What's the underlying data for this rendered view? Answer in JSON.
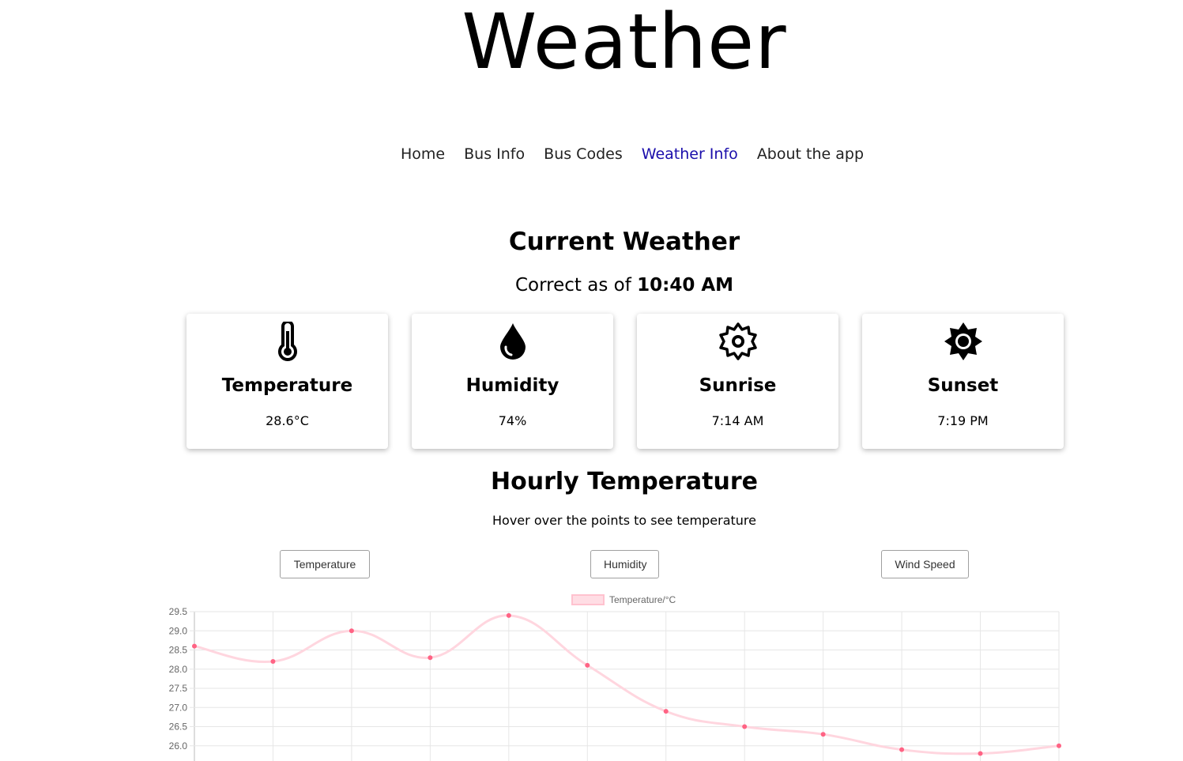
{
  "header": {
    "title": "Weather"
  },
  "nav": {
    "items": [
      {
        "label": "Home"
      },
      {
        "label": "Bus Info"
      },
      {
        "label": "Bus Codes"
      },
      {
        "label": "Weather Info",
        "active": true
      },
      {
        "label": "About the app"
      }
    ],
    "active_color": "#1a0dab"
  },
  "current": {
    "title": "Current Weather",
    "updated_prefix": "Correct as of",
    "updated_time": "10:40 AM",
    "cards": [
      {
        "icon": "thermometer-icon",
        "label": "Temperature",
        "value": "28.6°C"
      },
      {
        "icon": "water-drop-icon",
        "label": "Humidity",
        "value": "74%"
      },
      {
        "icon": "sunrise-gear-icon",
        "label": "Sunrise",
        "value": "7:14 AM"
      },
      {
        "icon": "sun-icon",
        "label": "Sunset",
        "value": "7:19 PM"
      }
    ]
  },
  "hourly": {
    "title": "Hourly Temperature",
    "hint": "Hover over the points to see temperature",
    "buttons": [
      "Temperature",
      "Humidity",
      "Wind Speed"
    ]
  },
  "chart_data": {
    "type": "line",
    "series": [
      {
        "name": "Temperature/°C",
        "values": [
          28.6,
          28.2,
          29.0,
          28.3,
          29.4,
          28.1,
          26.9,
          26.5,
          26.3,
          25.9,
          25.8,
          26.0
        ],
        "color": "#ff6384",
        "line_color": "#ffd6df"
      }
    ],
    "y_ticks": [
      "29.5",
      "29.0",
      "28.5",
      "28.0",
      "27.5",
      "27.0",
      "26.5",
      "26.0"
    ],
    "ylim": [
      25.6,
      29.5
    ],
    "grid": true,
    "legend": "top-center"
  }
}
